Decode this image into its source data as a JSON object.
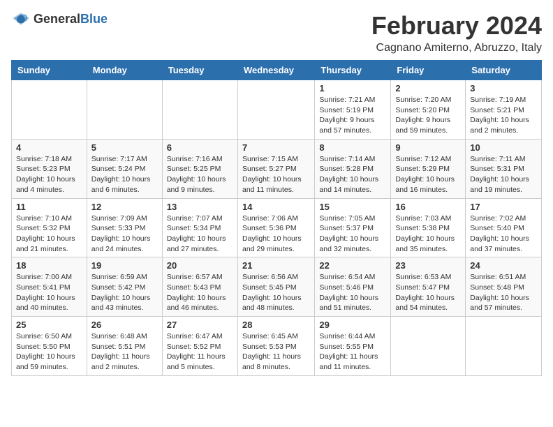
{
  "logo": {
    "text_general": "General",
    "text_blue": "Blue"
  },
  "title": "February 2024",
  "location": "Cagnano Amiterno, Abruzzo, Italy",
  "headers": [
    "Sunday",
    "Monday",
    "Tuesday",
    "Wednesday",
    "Thursday",
    "Friday",
    "Saturday"
  ],
  "weeks": [
    [
      {
        "day": "",
        "sunrise": "",
        "sunset": "",
        "daylight": ""
      },
      {
        "day": "",
        "sunrise": "",
        "sunset": "",
        "daylight": ""
      },
      {
        "day": "",
        "sunrise": "",
        "sunset": "",
        "daylight": ""
      },
      {
        "day": "",
        "sunrise": "",
        "sunset": "",
        "daylight": ""
      },
      {
        "day": "1",
        "sunrise": "Sunrise: 7:21 AM",
        "sunset": "Sunset: 5:19 PM",
        "daylight": "Daylight: 9 hours and 57 minutes."
      },
      {
        "day": "2",
        "sunrise": "Sunrise: 7:20 AM",
        "sunset": "Sunset: 5:20 PM",
        "daylight": "Daylight: 9 hours and 59 minutes."
      },
      {
        "day": "3",
        "sunrise": "Sunrise: 7:19 AM",
        "sunset": "Sunset: 5:21 PM",
        "daylight": "Daylight: 10 hours and 2 minutes."
      }
    ],
    [
      {
        "day": "4",
        "sunrise": "Sunrise: 7:18 AM",
        "sunset": "Sunset: 5:23 PM",
        "daylight": "Daylight: 10 hours and 4 minutes."
      },
      {
        "day": "5",
        "sunrise": "Sunrise: 7:17 AM",
        "sunset": "Sunset: 5:24 PM",
        "daylight": "Daylight: 10 hours and 6 minutes."
      },
      {
        "day": "6",
        "sunrise": "Sunrise: 7:16 AM",
        "sunset": "Sunset: 5:25 PM",
        "daylight": "Daylight: 10 hours and 9 minutes."
      },
      {
        "day": "7",
        "sunrise": "Sunrise: 7:15 AM",
        "sunset": "Sunset: 5:27 PM",
        "daylight": "Daylight: 10 hours and 11 minutes."
      },
      {
        "day": "8",
        "sunrise": "Sunrise: 7:14 AM",
        "sunset": "Sunset: 5:28 PM",
        "daylight": "Daylight: 10 hours and 14 minutes."
      },
      {
        "day": "9",
        "sunrise": "Sunrise: 7:12 AM",
        "sunset": "Sunset: 5:29 PM",
        "daylight": "Daylight: 10 hours and 16 minutes."
      },
      {
        "day": "10",
        "sunrise": "Sunrise: 7:11 AM",
        "sunset": "Sunset: 5:31 PM",
        "daylight": "Daylight: 10 hours and 19 minutes."
      }
    ],
    [
      {
        "day": "11",
        "sunrise": "Sunrise: 7:10 AM",
        "sunset": "Sunset: 5:32 PM",
        "daylight": "Daylight: 10 hours and 21 minutes."
      },
      {
        "day": "12",
        "sunrise": "Sunrise: 7:09 AM",
        "sunset": "Sunset: 5:33 PM",
        "daylight": "Daylight: 10 hours and 24 minutes."
      },
      {
        "day": "13",
        "sunrise": "Sunrise: 7:07 AM",
        "sunset": "Sunset: 5:34 PM",
        "daylight": "Daylight: 10 hours and 27 minutes."
      },
      {
        "day": "14",
        "sunrise": "Sunrise: 7:06 AM",
        "sunset": "Sunset: 5:36 PM",
        "daylight": "Daylight: 10 hours and 29 minutes."
      },
      {
        "day": "15",
        "sunrise": "Sunrise: 7:05 AM",
        "sunset": "Sunset: 5:37 PM",
        "daylight": "Daylight: 10 hours and 32 minutes."
      },
      {
        "day": "16",
        "sunrise": "Sunrise: 7:03 AM",
        "sunset": "Sunset: 5:38 PM",
        "daylight": "Daylight: 10 hours and 35 minutes."
      },
      {
        "day": "17",
        "sunrise": "Sunrise: 7:02 AM",
        "sunset": "Sunset: 5:40 PM",
        "daylight": "Daylight: 10 hours and 37 minutes."
      }
    ],
    [
      {
        "day": "18",
        "sunrise": "Sunrise: 7:00 AM",
        "sunset": "Sunset: 5:41 PM",
        "daylight": "Daylight: 10 hours and 40 minutes."
      },
      {
        "day": "19",
        "sunrise": "Sunrise: 6:59 AM",
        "sunset": "Sunset: 5:42 PM",
        "daylight": "Daylight: 10 hours and 43 minutes."
      },
      {
        "day": "20",
        "sunrise": "Sunrise: 6:57 AM",
        "sunset": "Sunset: 5:43 PM",
        "daylight": "Daylight: 10 hours and 46 minutes."
      },
      {
        "day": "21",
        "sunrise": "Sunrise: 6:56 AM",
        "sunset": "Sunset: 5:45 PM",
        "daylight": "Daylight: 10 hours and 48 minutes."
      },
      {
        "day": "22",
        "sunrise": "Sunrise: 6:54 AM",
        "sunset": "Sunset: 5:46 PM",
        "daylight": "Daylight: 10 hours and 51 minutes."
      },
      {
        "day": "23",
        "sunrise": "Sunrise: 6:53 AM",
        "sunset": "Sunset: 5:47 PM",
        "daylight": "Daylight: 10 hours and 54 minutes."
      },
      {
        "day": "24",
        "sunrise": "Sunrise: 6:51 AM",
        "sunset": "Sunset: 5:48 PM",
        "daylight": "Daylight: 10 hours and 57 minutes."
      }
    ],
    [
      {
        "day": "25",
        "sunrise": "Sunrise: 6:50 AM",
        "sunset": "Sunset: 5:50 PM",
        "daylight": "Daylight: 10 hours and 59 minutes."
      },
      {
        "day": "26",
        "sunrise": "Sunrise: 6:48 AM",
        "sunset": "Sunset: 5:51 PM",
        "daylight": "Daylight: 11 hours and 2 minutes."
      },
      {
        "day": "27",
        "sunrise": "Sunrise: 6:47 AM",
        "sunset": "Sunset: 5:52 PM",
        "daylight": "Daylight: 11 hours and 5 minutes."
      },
      {
        "day": "28",
        "sunrise": "Sunrise: 6:45 AM",
        "sunset": "Sunset: 5:53 PM",
        "daylight": "Daylight: 11 hours and 8 minutes."
      },
      {
        "day": "29",
        "sunrise": "Sunrise: 6:44 AM",
        "sunset": "Sunset: 5:55 PM",
        "daylight": "Daylight: 11 hours and 11 minutes."
      },
      {
        "day": "",
        "sunrise": "",
        "sunset": "",
        "daylight": ""
      },
      {
        "day": "",
        "sunrise": "",
        "sunset": "",
        "daylight": ""
      }
    ]
  ]
}
